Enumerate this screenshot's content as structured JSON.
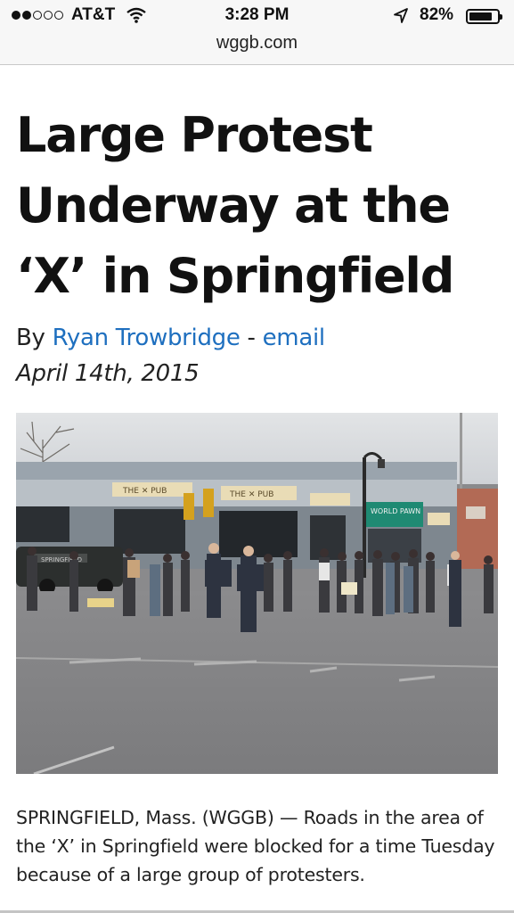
{
  "status_bar": {
    "carrier": "AT&T",
    "time": "3:28 PM",
    "battery_percent": "82%",
    "battery_level": 0.82,
    "signal_bars_filled": 2,
    "signal_bars_total": 5
  },
  "browser": {
    "url": "wggb.com"
  },
  "article": {
    "title": "Large Protest Underway at the ‘X’ in Springfield",
    "byline_prefix": "By ",
    "author": "Ryan Trowbridge",
    "separator": " - ",
    "email_label": "email",
    "date": "April 14th, 2015",
    "image_alt": "Protesters and police gathered at the intersection in front of THE X PUB storefronts",
    "body": "SPRINGFIELD, Mass. (WGGB) — Roads in the area of the ‘X’ in Springfield were blocked for a time Tuesday because of a large group of protesters."
  },
  "icons": [
    "signal-dots-icon",
    "wifi-icon",
    "location-arrow-icon",
    "battery-icon"
  ]
}
